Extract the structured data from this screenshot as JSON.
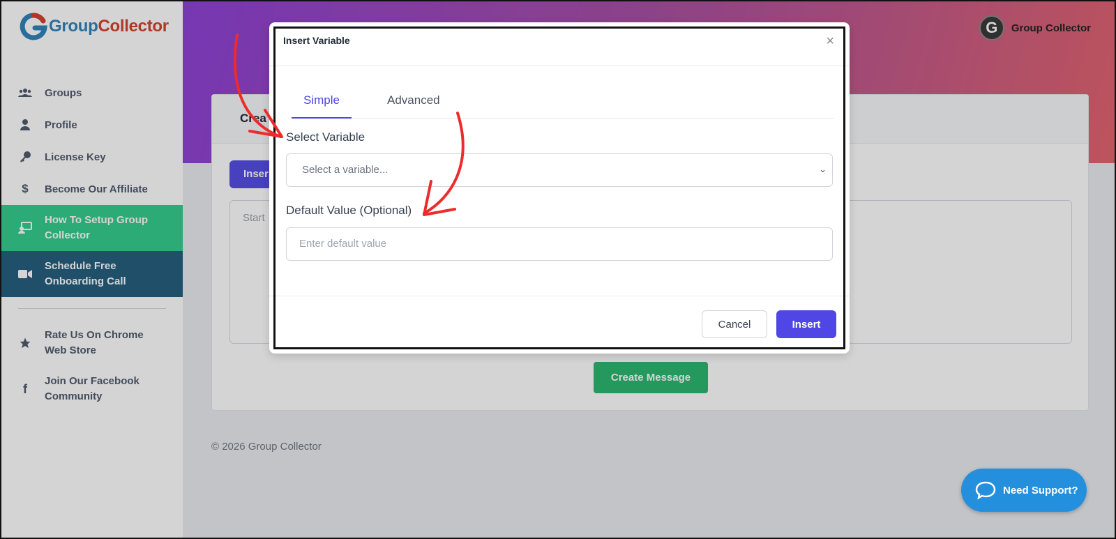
{
  "brand": {
    "logo_text_1": "Group",
    "logo_text_2": "Collector"
  },
  "sidebar": {
    "items": [
      {
        "label": "Groups",
        "icon": "users-icon"
      },
      {
        "label": "Profile",
        "icon": "user-icon"
      },
      {
        "label": "License Key",
        "icon": "key-icon"
      },
      {
        "label": "Become Our Affiliate",
        "icon": "dollar-icon"
      },
      {
        "label": "How To Setup Group Collector",
        "icon": "teacher-icon"
      },
      {
        "label": "Schedule Free Onboarding Call",
        "icon": "video-icon"
      },
      {
        "label": "Rate Us On Chrome Web Store",
        "icon": "star-icon"
      },
      {
        "label": "Join Our Facebook Community",
        "icon": "facebook-icon"
      }
    ]
  },
  "header": {
    "user_initial": "G",
    "user_name": "Group Collector"
  },
  "card": {
    "title": "Crea",
    "insert_button": "Inser",
    "textarea_placeholder": "Start",
    "create_button": "Create Message"
  },
  "footer": {
    "copyright": "© 2026 Group Collector"
  },
  "support": {
    "label": "Need Support?"
  },
  "modal": {
    "title": "Insert Variable",
    "close": "×",
    "tabs": [
      "Simple",
      "Advanced"
    ],
    "select_label": "Select Variable",
    "select_placeholder": "Select a variable...",
    "default_label": "Default Value (Optional)",
    "default_placeholder": "Enter default value",
    "cancel": "Cancel",
    "insert": "Insert"
  },
  "colors": {
    "primary": "#4f46e5",
    "green": "#2ecc8a",
    "navy": "#1e5a7a",
    "arrow": "#ee2b2b"
  }
}
